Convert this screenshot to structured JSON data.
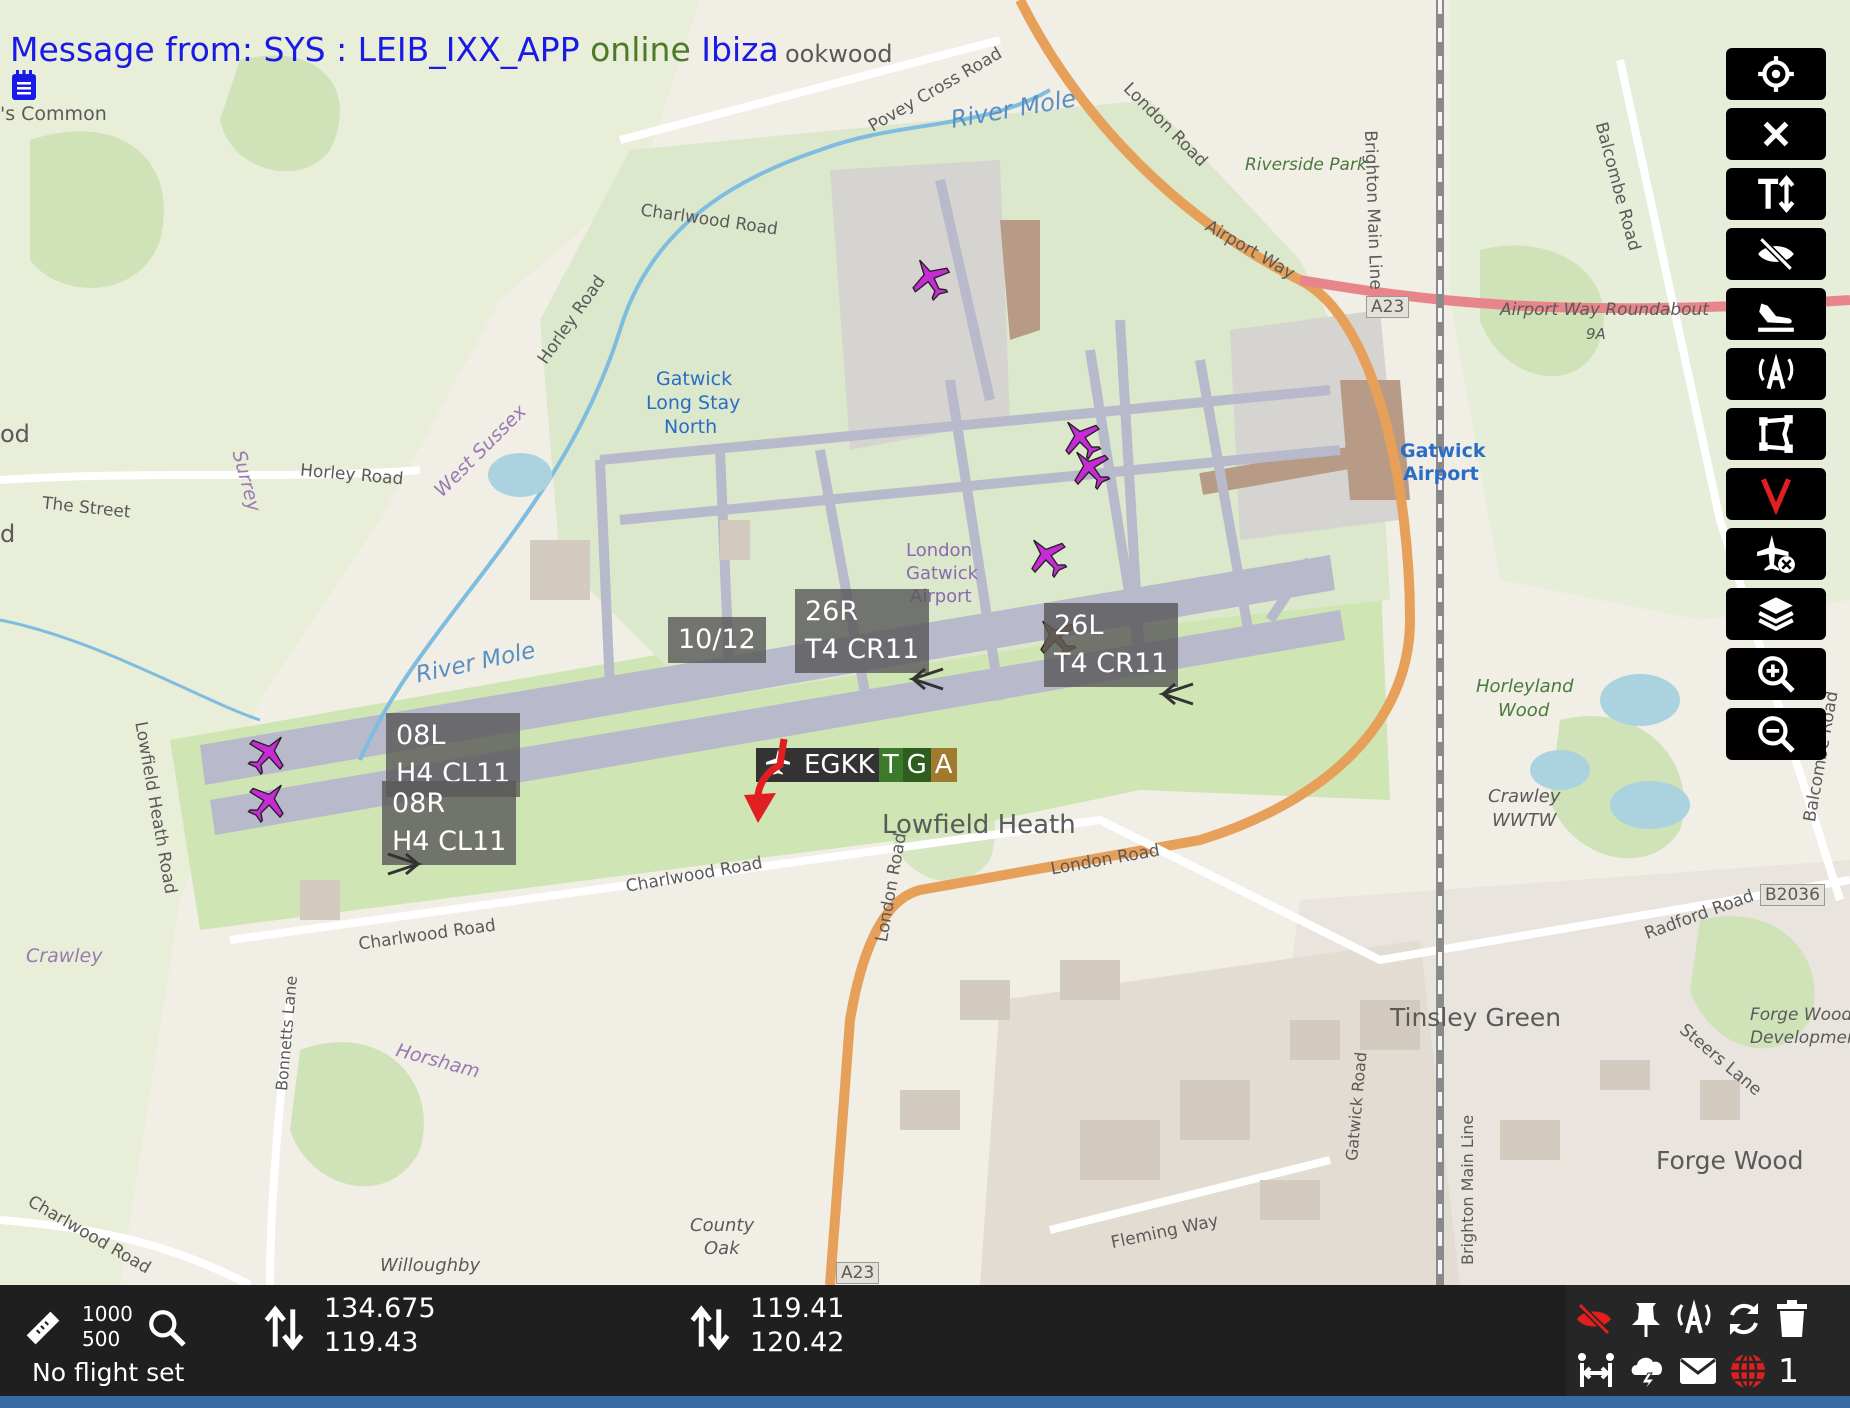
{
  "message": {
    "prefix": "Message from: SYS : LEIB_IXX_APP",
    "status": "online",
    "place": "Ibiza"
  },
  "map_labels": [
    "'s Common",
    "ookwood",
    "Povey Cross Road",
    "River Mole",
    "London Road",
    "Riverside Park",
    "Brighton Main Line",
    "Balcombe Road",
    "Charlwood Road",
    "Horley Road",
    "Airport Way",
    "A23",
    "Airport Way Roundabout",
    "9A",
    "Gatwick",
    "Long Stay",
    "North",
    "West Sussex",
    "Surrey",
    "Horley Road",
    "The Street",
    "London",
    "Gatwick",
    "Airport",
    "Gatwick",
    "Airport",
    "River Mole",
    "Horleyland",
    "Wood",
    "Crawley",
    "WWTW",
    "Lowfield Heath",
    "Lowfield Heath Road",
    "Charlwood Road",
    "London Road",
    "Charlwood Road",
    "Crawley",
    "Horsham",
    "London Road",
    "Tinsley Green",
    "Radford Road",
    "B2036",
    "Balcombe Road",
    "Forge Wood",
    "Development",
    "Steers Lane",
    "Forge Wood",
    "Bonnetts Lane",
    "Charlwood Road",
    "County",
    "Oak",
    "Gatwick Road",
    "Fleming Way",
    "Brighton Main Line",
    "Willoughby",
    "A23",
    "od",
    "d"
  ],
  "runway_labels": [
    {
      "line1": "10/12",
      "line2": ""
    },
    {
      "line1": "26R",
      "line2": "T4 CR11"
    },
    {
      "line1": "26L",
      "line2": "T4 CR11"
    },
    {
      "line1": "08L",
      "line2": "H4 CL11"
    },
    {
      "line1": "08R",
      "line2": "H4 CL11"
    }
  ],
  "airport_tag": {
    "code": "EGKK",
    "flags": [
      "T",
      "G",
      "A"
    ],
    "flag_colors": [
      "#3b7a2a",
      "#2f5d1f",
      "#a07a2e"
    ]
  },
  "toolbar": [
    "crosshair-icon",
    "close-icon",
    "text-size-icon",
    "hide-labels-icon",
    "landing-icon",
    "atc-icon",
    "area-icon",
    "vector-icon",
    "remove-aircraft-icon",
    "layers-icon",
    "zoom-in-icon",
    "zoom-out-icon"
  ],
  "footer": {
    "range_top": "1000",
    "range_bottom": "500",
    "flight_status": "No flight set",
    "freq1_top": "134.675",
    "freq1_bottom": "119.43",
    "freq2_top": "119.41",
    "freq2_bottom": "120.42",
    "counter": "1"
  },
  "colors": {
    "plane_magenta": "#c62bd6",
    "plane_brown": "#8a5a2b",
    "message_blue": "#1a1ae6",
    "online_green": "#4d7a2a",
    "toolbar_bg": "#000000",
    "footer_bg": "#1f1f1f",
    "alert_red": "#e02020"
  }
}
